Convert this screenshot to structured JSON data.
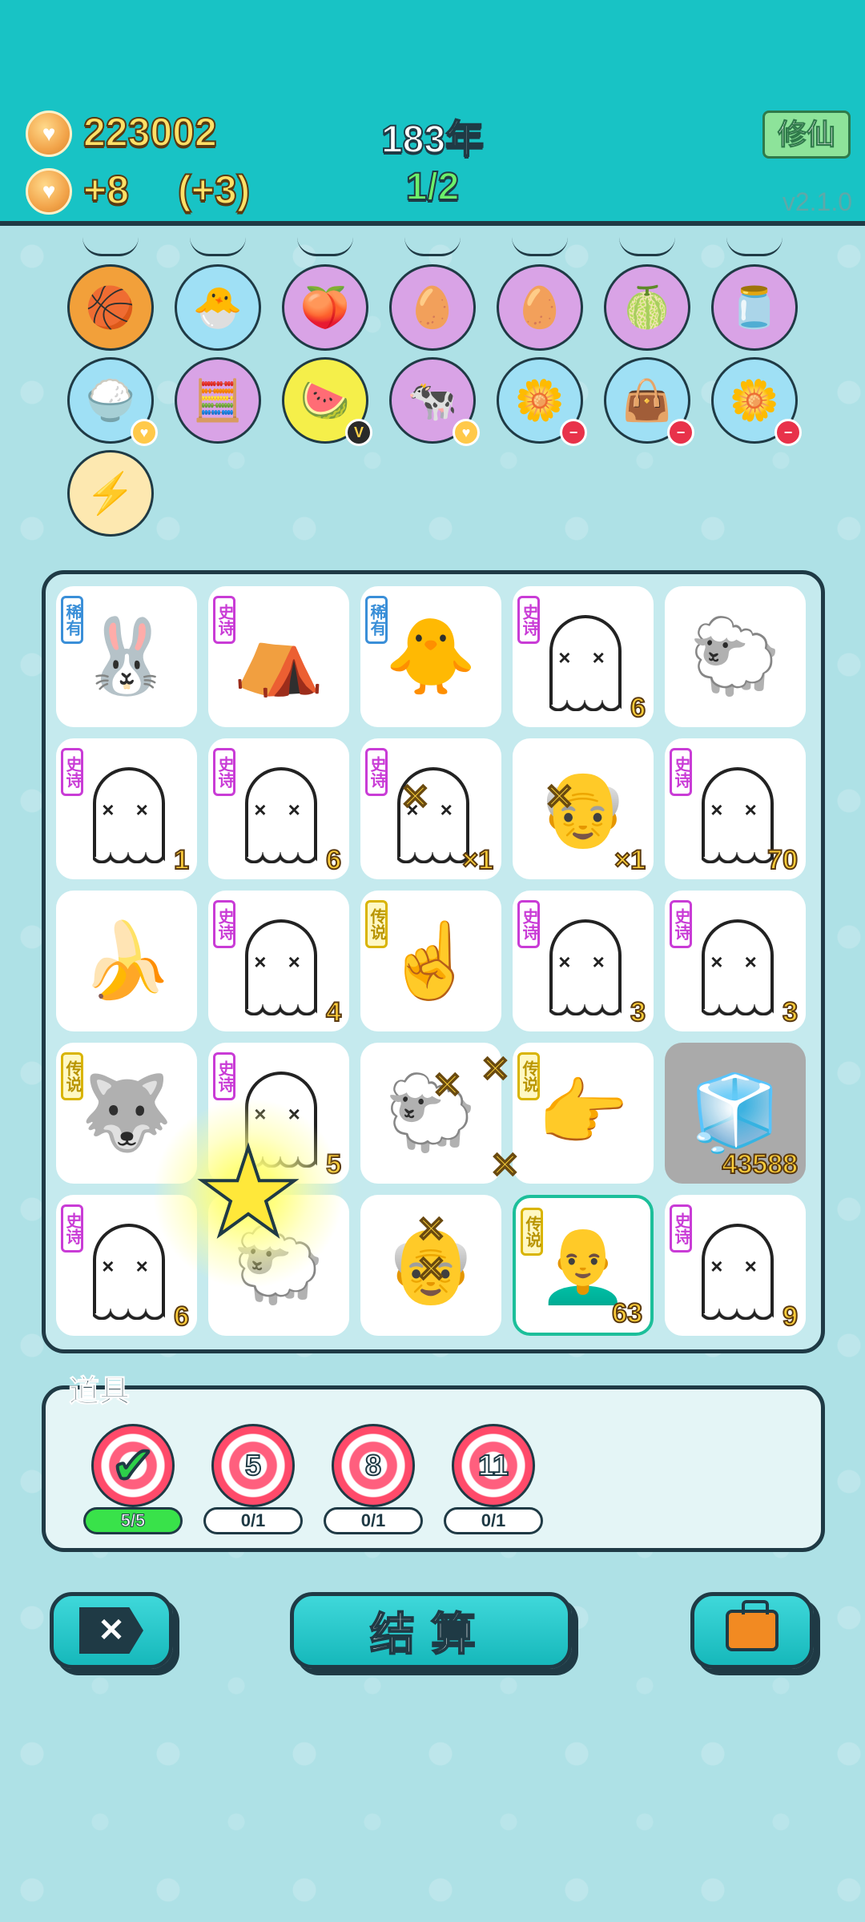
{
  "header": {
    "gold_total": "223002",
    "gold_income": "+8",
    "gold_bonus": "(+3)",
    "year": "183年",
    "round": "1/2",
    "xiuxian_button": "修仙",
    "version": "v2.1.0"
  },
  "effects": [
    {
      "name": "basketballs-icon",
      "bg": "#f2a03a",
      "glyph": "🏀",
      "badge": ""
    },
    {
      "name": "chick-egg-icon",
      "bg": "#9fe0f5",
      "glyph": "🐣",
      "badge": ""
    },
    {
      "name": "peach-sunglasses-icon",
      "bg": "#d9a3e6",
      "glyph": "🍑",
      "badge": ""
    },
    {
      "name": "cracked-egg-icon",
      "bg": "#d9a3e6",
      "glyph": "🥚",
      "badge": ""
    },
    {
      "name": "cracked-egg-icon-2",
      "bg": "#d9a3e6",
      "glyph": "🥚",
      "badge": ""
    },
    {
      "name": "pomelo-icon",
      "bg": "#d9a3e6",
      "glyph": "🍈",
      "badge": ""
    },
    {
      "name": "jar-icon",
      "bg": "#d9a3e6",
      "glyph": "🫙",
      "badge": ""
    },
    {
      "name": "rice-bowl-icon",
      "bg": "#9fe0f5",
      "glyph": "🍚",
      "badge": "heart"
    },
    {
      "name": "math-student-icon",
      "bg": "#d9a3e6",
      "glyph": "🧮",
      "badge": ""
    },
    {
      "name": "fruit-basket-icon",
      "bg": "#f5ef4a",
      "glyph": "🍉",
      "badge": "vip"
    },
    {
      "name": "twin-cows-icon",
      "bg": "#d9a3e6",
      "glyph": "🐄",
      "badge": "heart"
    },
    {
      "name": "potted-flower-icon",
      "bg": "#9fe0f5",
      "glyph": "🌼",
      "badge": "minus"
    },
    {
      "name": "seed-bag-icon",
      "bg": "#9fe0f5",
      "glyph": "👜",
      "badge": "minus"
    },
    {
      "name": "potted-flower-icon-2",
      "bg": "#9fe0f5",
      "glyph": "🌼",
      "badge": "minus"
    },
    {
      "name": "lightning-icon",
      "bg": "#fde8b0",
      "glyph": "⚡",
      "badge": ""
    }
  ],
  "board": [
    {
      "kind": "rabbit",
      "glyph": "🐰",
      "rarity": "稀有",
      "rclass": "rare",
      "count": ""
    },
    {
      "kind": "rabbit-tent",
      "glyph": "⛺",
      "rarity": "史诗",
      "rclass": "epic",
      "count": ""
    },
    {
      "kind": "chick",
      "glyph": "🐥",
      "rarity": "稀有",
      "rclass": "rare",
      "count": ""
    },
    {
      "kind": "ghost",
      "glyph": "",
      "rarity": "史诗",
      "rclass": "epic",
      "count": "6"
    },
    {
      "kind": "sheep",
      "glyph": "🐑",
      "rarity": "",
      "rclass": "",
      "count": ""
    },
    {
      "kind": "ghost",
      "glyph": "",
      "rarity": "史诗",
      "rclass": "epic",
      "count": "1"
    },
    {
      "kind": "ghost",
      "glyph": "",
      "rarity": "史诗",
      "rclass": "epic",
      "count": "6"
    },
    {
      "kind": "ghost",
      "glyph": "",
      "rarity": "史诗",
      "rclass": "epic",
      "count": "×1"
    },
    {
      "kind": "old-man",
      "glyph": "👴",
      "rarity": "",
      "rclass": "",
      "count": "×1"
    },
    {
      "kind": "ghost",
      "glyph": "",
      "rarity": "史诗",
      "rclass": "epic",
      "count": "70"
    },
    {
      "kind": "banana",
      "glyph": "🍌",
      "rarity": "",
      "rclass": "",
      "count": ""
    },
    {
      "kind": "ghost",
      "glyph": "",
      "rarity": "史诗",
      "rclass": "epic",
      "count": "4"
    },
    {
      "kind": "pointing-hand",
      "glyph": "☝",
      "rarity": "传说",
      "rclass": "legend",
      "count": ""
    },
    {
      "kind": "ghost",
      "glyph": "",
      "rarity": "史诗",
      "rclass": "epic",
      "count": "3"
    },
    {
      "kind": "ghost",
      "glyph": "",
      "rarity": "史诗",
      "rclass": "epic",
      "count": "3"
    },
    {
      "kind": "husky-king",
      "glyph": "🐺",
      "rarity": "传说",
      "rclass": "legend",
      "count": ""
    },
    {
      "kind": "ghost",
      "glyph": "",
      "rarity": "史诗",
      "rclass": "epic",
      "count": "5"
    },
    {
      "kind": "big-sheep",
      "glyph": "🐑",
      "rarity": "",
      "rclass": "",
      "count": ""
    },
    {
      "kind": "pointing-hand",
      "glyph": "👉",
      "rarity": "传说",
      "rclass": "legend",
      "count": ""
    },
    {
      "kind": "fridge",
      "glyph": "🧊",
      "rarity": "",
      "rclass": "",
      "count": "43588"
    },
    {
      "kind": "ghost",
      "glyph": "",
      "rarity": "史诗",
      "rclass": "epic",
      "count": "6"
    },
    {
      "kind": "sheep",
      "glyph": "🐑",
      "rarity": "",
      "rclass": "",
      "count": ""
    },
    {
      "kind": "old-man",
      "glyph": "👴",
      "rarity": "",
      "rclass": "",
      "count": ""
    },
    {
      "kind": "bald-man",
      "glyph": "👨‍🦲",
      "rarity": "传说",
      "rclass": "legend",
      "count": "63"
    },
    {
      "kind": "ghost",
      "glyph": "",
      "rarity": "史诗",
      "rclass": "epic",
      "count": "9"
    }
  ],
  "items": {
    "title": "道具",
    "tools": [
      {
        "label": "✔",
        "progress": "5/5",
        "done": true
      },
      {
        "label": "5",
        "progress": "0/1",
        "done": false
      },
      {
        "label": "8",
        "progress": "0/1",
        "done": false
      },
      {
        "label": "11",
        "progress": "0/1",
        "done": false
      }
    ]
  },
  "buttons": {
    "close": "✕",
    "settle": "结算"
  },
  "colors": {
    "header_bg": "#18c3c5",
    "page_bg": "#aee1e6",
    "gold": "#ffe066",
    "round_green": "#6cf06a",
    "epic": "#c93cd6",
    "rare": "#3a8fd8",
    "legend": "#d9b400"
  }
}
